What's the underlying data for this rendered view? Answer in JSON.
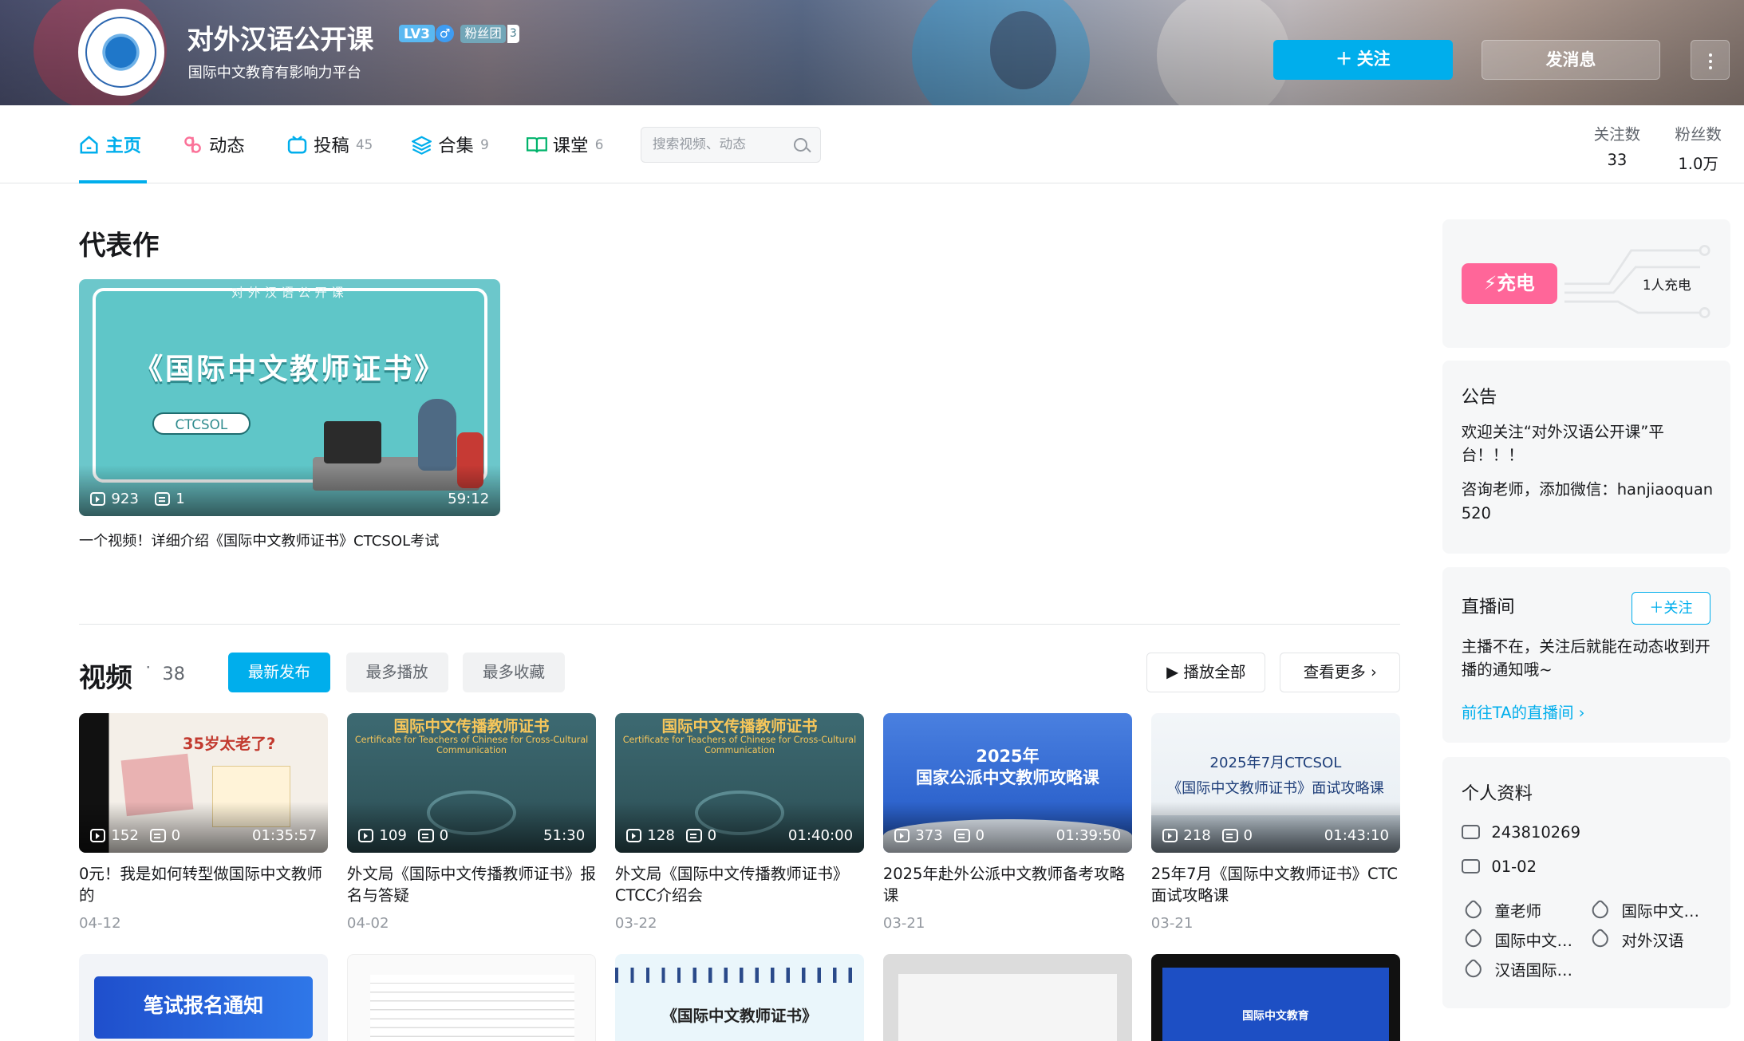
{
  "header": {
    "username": "对外汉语公开课",
    "level_badge": "LV3",
    "gender_icon": "♂",
    "fans_badge": "粉丝团",
    "fans_badge_level": "3",
    "sign": "国际中文教育有影响力平台",
    "follow_label": "关注",
    "message_label": "发消息"
  },
  "nav": {
    "items": [
      {
        "label": "主页",
        "count": ""
      },
      {
        "label": "动态",
        "count": ""
      },
      {
        "label": "投稿",
        "count": "45"
      },
      {
        "label": "合集",
        "count": "9"
      },
      {
        "label": "课堂",
        "count": "6"
      }
    ],
    "search_placeholder": "搜索视频、动态",
    "following_label": "关注数",
    "following_value": "33",
    "fans_label": "粉丝数",
    "fans_value": "1.0万"
  },
  "masterpiece": {
    "section_title": "代表作",
    "thumb_header": "对外汉语公开课",
    "thumb_title": "《国际中文教师证书》",
    "thumb_tag": "CTCSOL",
    "plays": "923",
    "comments": "1",
    "duration": "59:12",
    "title": "一个视频！详细介绍《国际中文教师证书》CTCSOL考试"
  },
  "videos": {
    "section_title": "视频",
    "count": "38",
    "tabs": [
      "最新发布",
      "最多播放",
      "最多收藏"
    ],
    "play_all": "播放全部",
    "view_more": "查看更多",
    "items": [
      {
        "plays": "152",
        "comments": "0",
        "duration": "01:35:57",
        "title": "0元！我是如何转型做国际中文教师的",
        "date": "04-12",
        "thumb_text": "35岁太老了?"
      },
      {
        "plays": "109",
        "comments": "0",
        "duration": "51:30",
        "title": "外文局《国际中文传播教师证书》报名与答疑",
        "date": "04-02",
        "thumb_text": "国际中文传播教师证书"
      },
      {
        "plays": "128",
        "comments": "0",
        "duration": "01:40:00",
        "title": "外文局《国际中文传播教师证书》CTCC介绍会",
        "date": "03-22",
        "thumb_text": "国际中文传播教师证书"
      },
      {
        "plays": "373",
        "comments": "0",
        "duration": "01:39:50",
        "title": "2025年赴外公派中文教师备考攻略课",
        "date": "03-21",
        "thumb_text": "2025年\n国家公派中文教师攻略课"
      },
      {
        "plays": "218",
        "comments": "0",
        "duration": "01:43:10",
        "title": "25年7月《国际中文教师证书》CTC面试攻略课",
        "date": "03-21",
        "thumb_text": "2025年7月CTCSOL\n《国际中文教师证书》面试攻略课"
      }
    ],
    "row2_texts": [
      "笔试报名通知",
      "",
      "《国际中文教师证书》",
      "",
      "国际中文教育"
    ]
  },
  "sidebar": {
    "charge_label": "充电",
    "charge_count": "1人充电",
    "notice_title": "公告",
    "notice_p1": "欢迎关注“对外汉语公开课”平台！！！",
    "notice_p2": "咨询老师，添加微信：hanjiaoquan520",
    "live_title": "直播间",
    "live_follow": "关注",
    "live_text": "主播不在，关注后就能在动态收到开播的通知哦~",
    "live_link": "前往TA的直播间",
    "profile_title": "个人资料",
    "uid": "243810269",
    "birthday": "01-02",
    "tags": [
      "童老师",
      "国际中文…",
      "国际中文…",
      "对外汉语",
      "汉语国际…"
    ]
  },
  "colors": {
    "accent": "#00aeec",
    "charge": "#ff6699"
  }
}
